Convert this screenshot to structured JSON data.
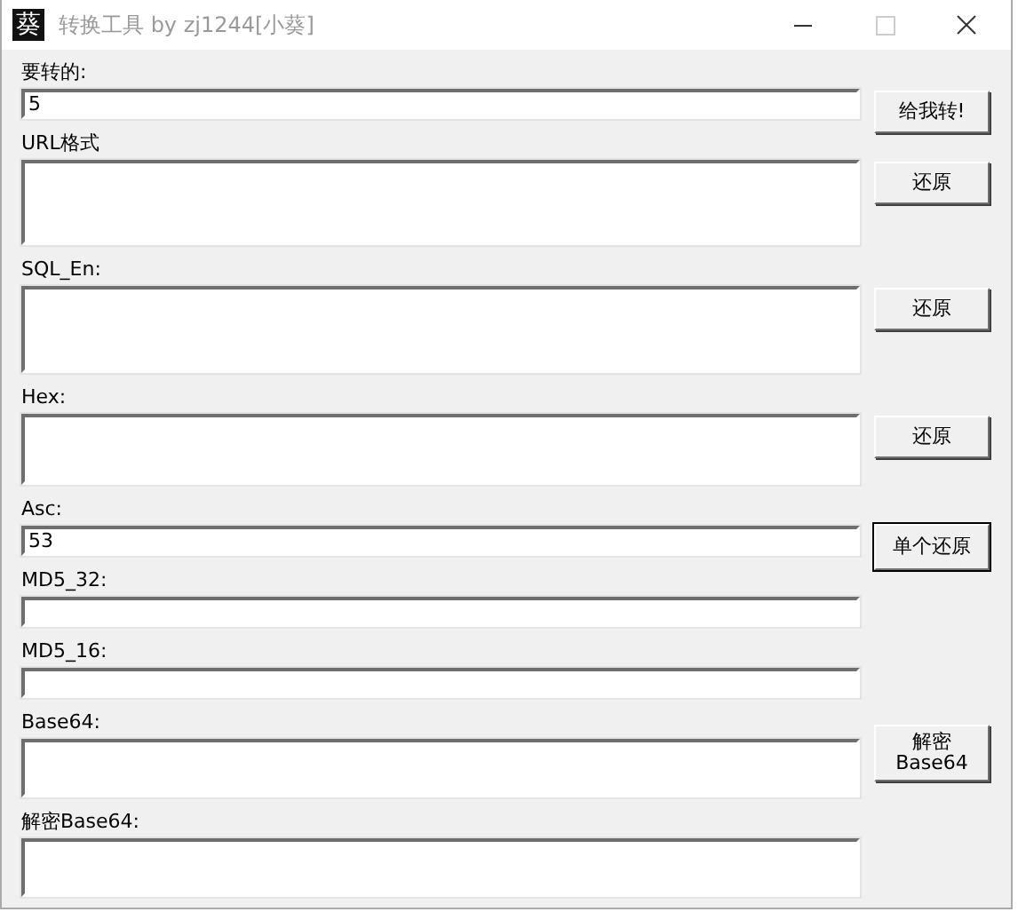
{
  "window": {
    "icon_glyph": "葵",
    "title": "转换工具 by zj1244[小葵]",
    "controls": [
      {
        "kind": "minimize",
        "disabled": false
      },
      {
        "kind": "maximize",
        "disabled": true
      },
      {
        "kind": "close",
        "disabled": false
      }
    ]
  },
  "sections": [
    {
      "label": "要转的:",
      "kind": "line",
      "value": "5",
      "button": {
        "label": "给我转!",
        "default": false
      }
    },
    {
      "label": "URL格式",
      "kind": "box",
      "button": {
        "label": "还原",
        "default": false
      }
    },
    {
      "label": "SQL_En:",
      "kind": "box",
      "button": {
        "label": "还原",
        "default": false
      }
    },
    {
      "label": "Hex:",
      "kind": "box",
      "button": {
        "label": "还原",
        "default": false
      }
    },
    {
      "label": "Asc:",
      "kind": "line",
      "value": "53",
      "button": {
        "label": "单个还原",
        "default": true
      }
    },
    {
      "label": "MD5_32:",
      "kind": "line"
    },
    {
      "label": "MD5_16:",
      "kind": "line"
    },
    {
      "label": "Base64:",
      "kind": "box",
      "button": {
        "label": "解密\nBase64",
        "default": false
      }
    },
    {
      "label": "解密Base64:",
      "kind": "box"
    }
  ]
}
